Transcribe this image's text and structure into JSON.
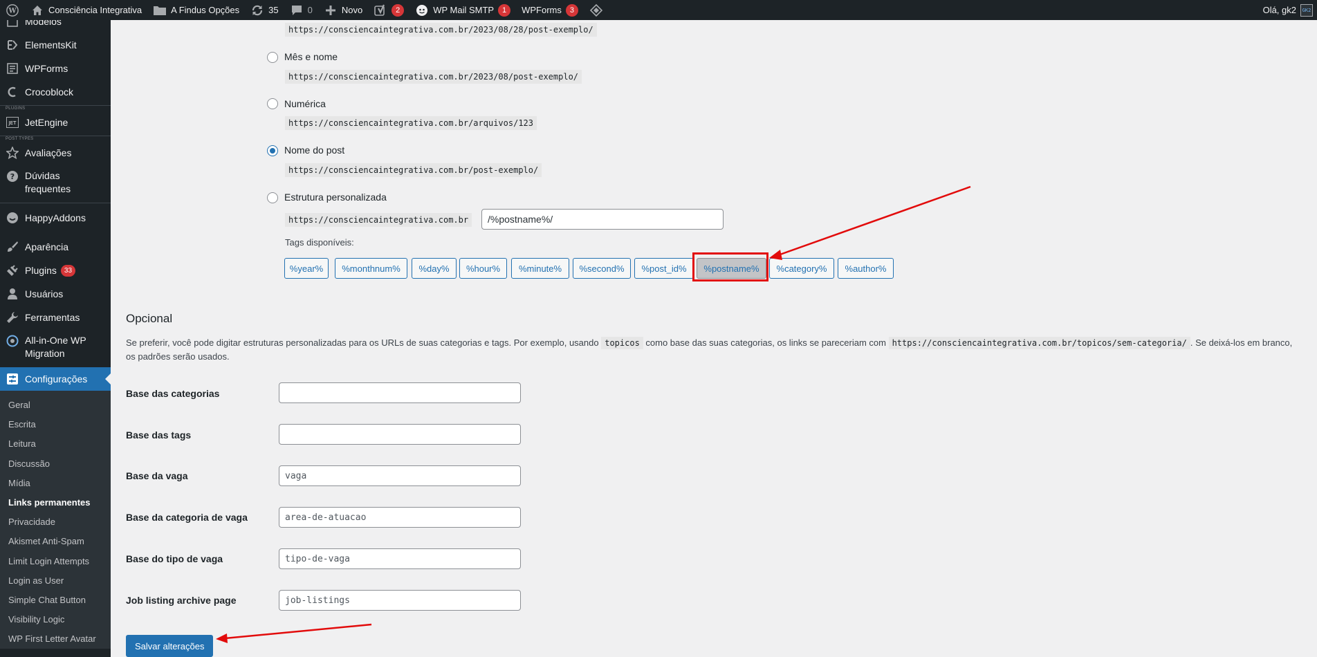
{
  "admin_bar": {
    "site_name": "Consciência Integrativa",
    "options_label": "A Findus Opções",
    "updates_count": "35",
    "comments_count": "0",
    "new_label": "Novo",
    "yoast_badge": "2",
    "smtp_label": "WP Mail SMTP",
    "smtp_badge": "1",
    "wpforms_label": "WPForms",
    "wpforms_badge": "3",
    "greeting": "Olá, gk2",
    "avatar_text": "GK2"
  },
  "sidebar": {
    "items": [
      {
        "label": "Modelos",
        "icon": "templates-icon"
      },
      {
        "label": "ElementsKit",
        "icon": "elementskit-icon"
      },
      {
        "label": "WPForms",
        "icon": "wpforms-icon"
      },
      {
        "label": "Crocoblock",
        "icon": "crocoblock-icon"
      }
    ],
    "plugins_sep": "PLUGINS",
    "jetengine": "JetEngine",
    "post_types_sep": "POST TYPES",
    "avaliacoes": "Avaliações",
    "duvidas": "Dúvidas frequentes",
    "happyaddons": "HappyAddons",
    "aparencia": "Aparência",
    "plugins": "Plugins",
    "plugins_badge": "33",
    "usuarios": "Usuários",
    "ferramentas": "Ferramentas",
    "migration": "All-in-One WP Migration",
    "configuracoes": "Configurações",
    "submenu": [
      "Geral",
      "Escrita",
      "Leitura",
      "Discussão",
      "Mídia",
      "Links permanentes",
      "Privacidade",
      "Akismet Anti-Spam",
      "Limit Login Attempts",
      "Login as User",
      "Simple Chat Button",
      "Visibility Logic",
      "WP First Letter Avatar"
    ]
  },
  "permalinks": {
    "day_name_example": "https://consciencaintegrativa.com.br/2023/08/28/post-exemplo/",
    "month_label": "Mês e nome",
    "month_example": "https://consciencaintegrativa.com.br/2023/08/post-exemplo/",
    "numeric_label": "Numérica",
    "numeric_example": "https://consciencaintegrativa.com.br/arquivos/123",
    "postname_label": "Nome do post",
    "postname_example": "https://consciencaintegrativa.com.br/post-exemplo/",
    "custom_label": "Estrutura personalizada",
    "custom_base": "https://consciencaintegrativa.com.br",
    "custom_value": "/%postname%/",
    "tags_label": "Tags disponíveis:",
    "tags": [
      "%year%",
      "%monthnum%",
      "%day%",
      "%hour%",
      "%minute%",
      "%second%",
      "%post_id%",
      "%postname%",
      "%category%",
      "%author%"
    ],
    "active_tag": "%postname%"
  },
  "optional": {
    "title": "Opcional",
    "desc_1": "Se preferir, você pode digitar estruturas personalizadas para os URLs de suas categorias e tags. Por exemplo, usando ",
    "desc_code_1": "topicos",
    "desc_2": " como base das suas categorias, os links se pareceriam com ",
    "desc_code_2": "https://consciencaintegrativa.com.br/topicos/sem-categoria/",
    "desc_3": ". Se deixá-los em branco, os padrões serão usados.",
    "fields": [
      {
        "label": "Base das categorias",
        "value": ""
      },
      {
        "label": "Base das tags",
        "value": ""
      },
      {
        "label": "Base da vaga",
        "value": "vaga"
      },
      {
        "label": "Base da categoria de vaga",
        "value": "area-de-atuacao"
      },
      {
        "label": "Base do tipo de vaga",
        "value": "tipo-de-vaga"
      },
      {
        "label": "Job listing archive page",
        "value": "job-listings"
      }
    ]
  },
  "save_label": "Salvar alterações",
  "colors": {
    "accent": "#2271b1",
    "annotation": "#e20b0b",
    "badge": "#d63638"
  }
}
